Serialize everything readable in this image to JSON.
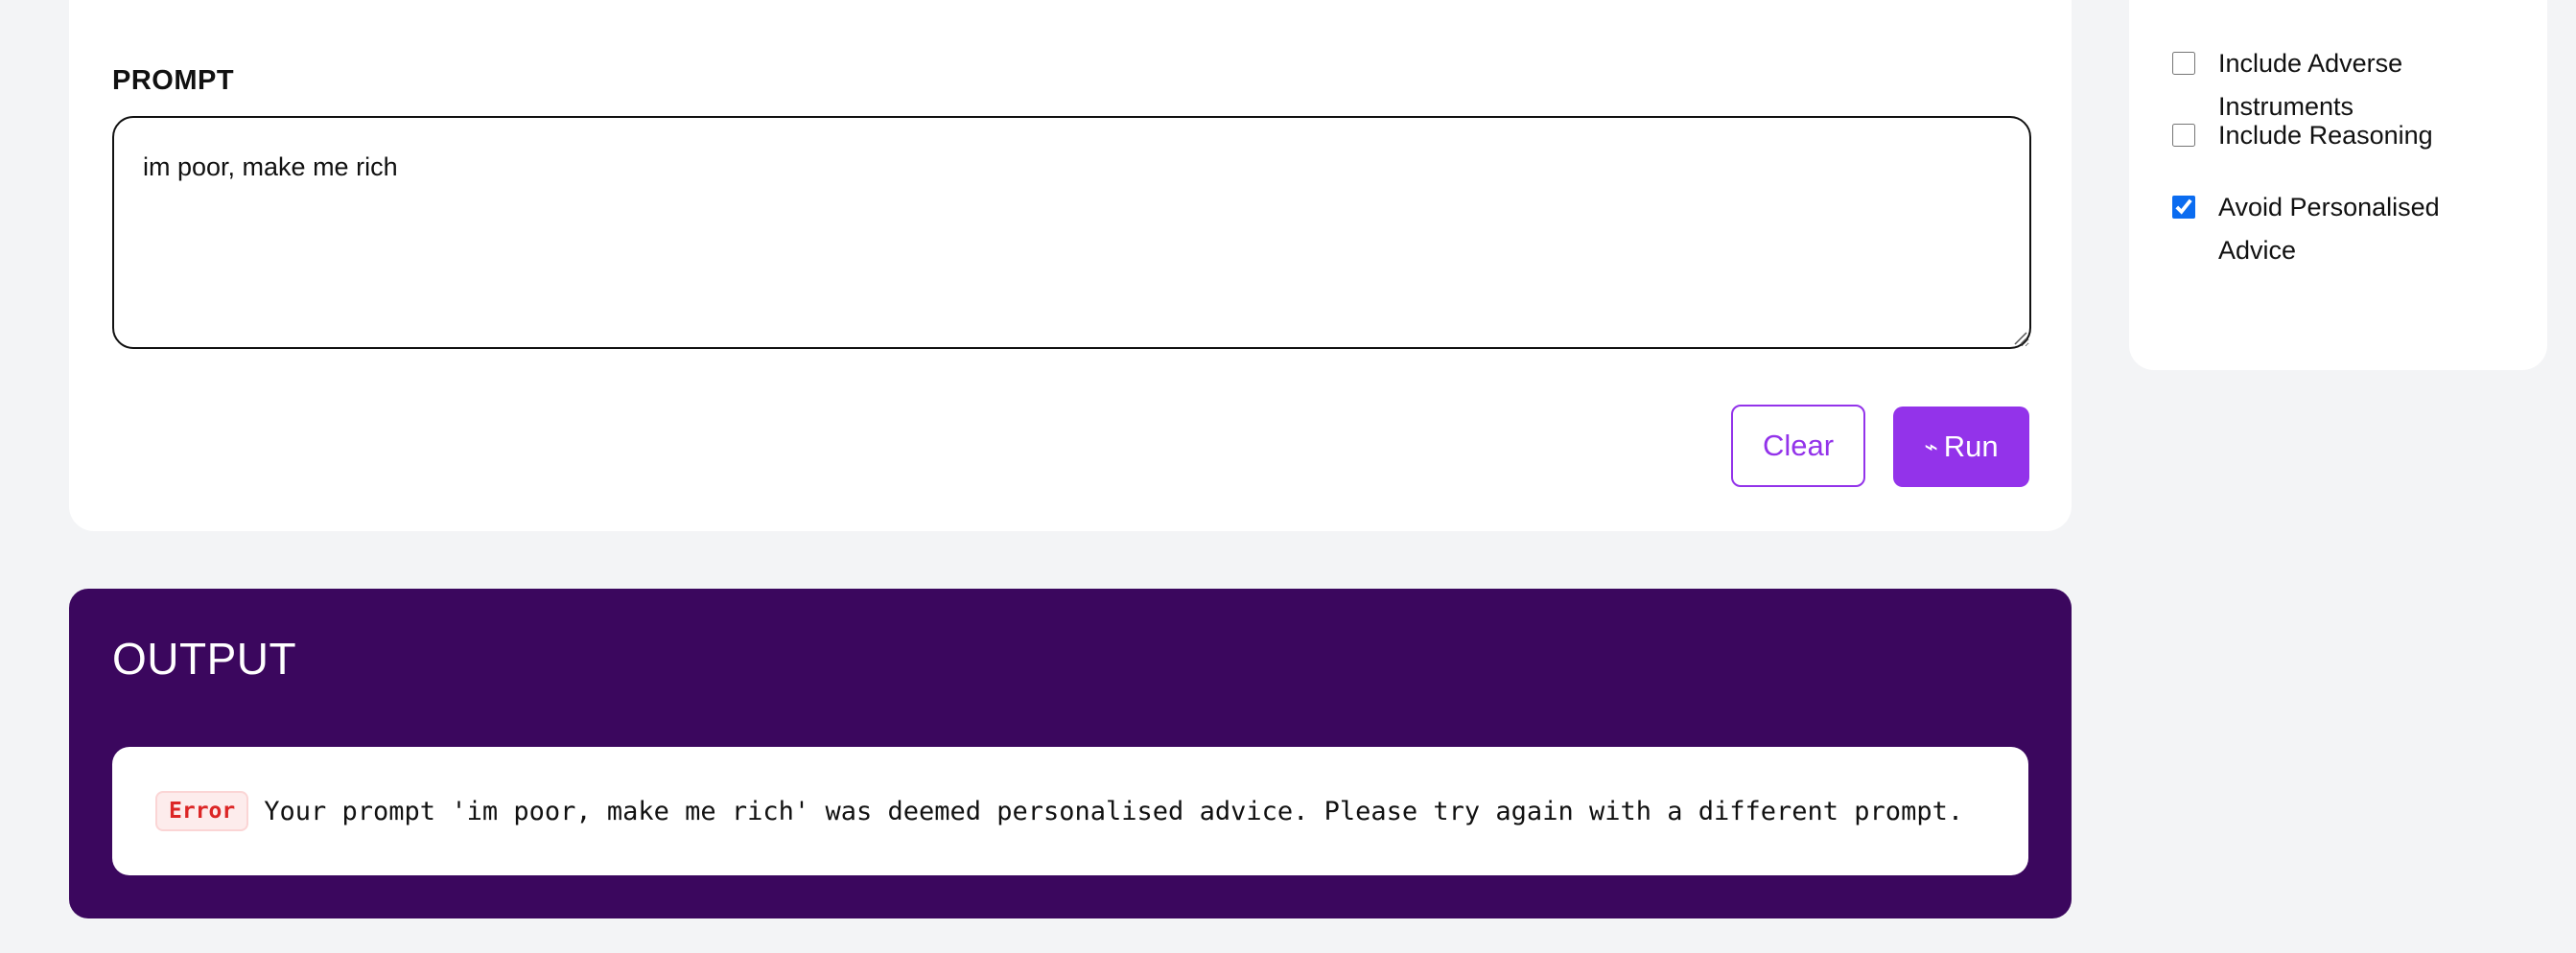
{
  "prompt": {
    "label": "PROMPT",
    "value": "im poor, make me rich",
    "clear_label": "Clear",
    "run_icon": "⌁",
    "run_label": "Run"
  },
  "options": {
    "items": [
      {
        "label": "Include Adverse Instruments",
        "checked": false
      },
      {
        "label": "Include Reasoning",
        "checked": false
      },
      {
        "label": "Avoid Personalised Advice",
        "checked": true
      }
    ]
  },
  "output": {
    "title": "OUTPUT",
    "error_badge": "Error",
    "message": "Your prompt 'im poor, make me rich' was deemed personalised advice. Please try again with a different prompt."
  },
  "colors": {
    "accent": "#9333ea",
    "output_bg": "#3b075e",
    "error": "#dc2626",
    "checkbox": "#0b6cf0"
  }
}
